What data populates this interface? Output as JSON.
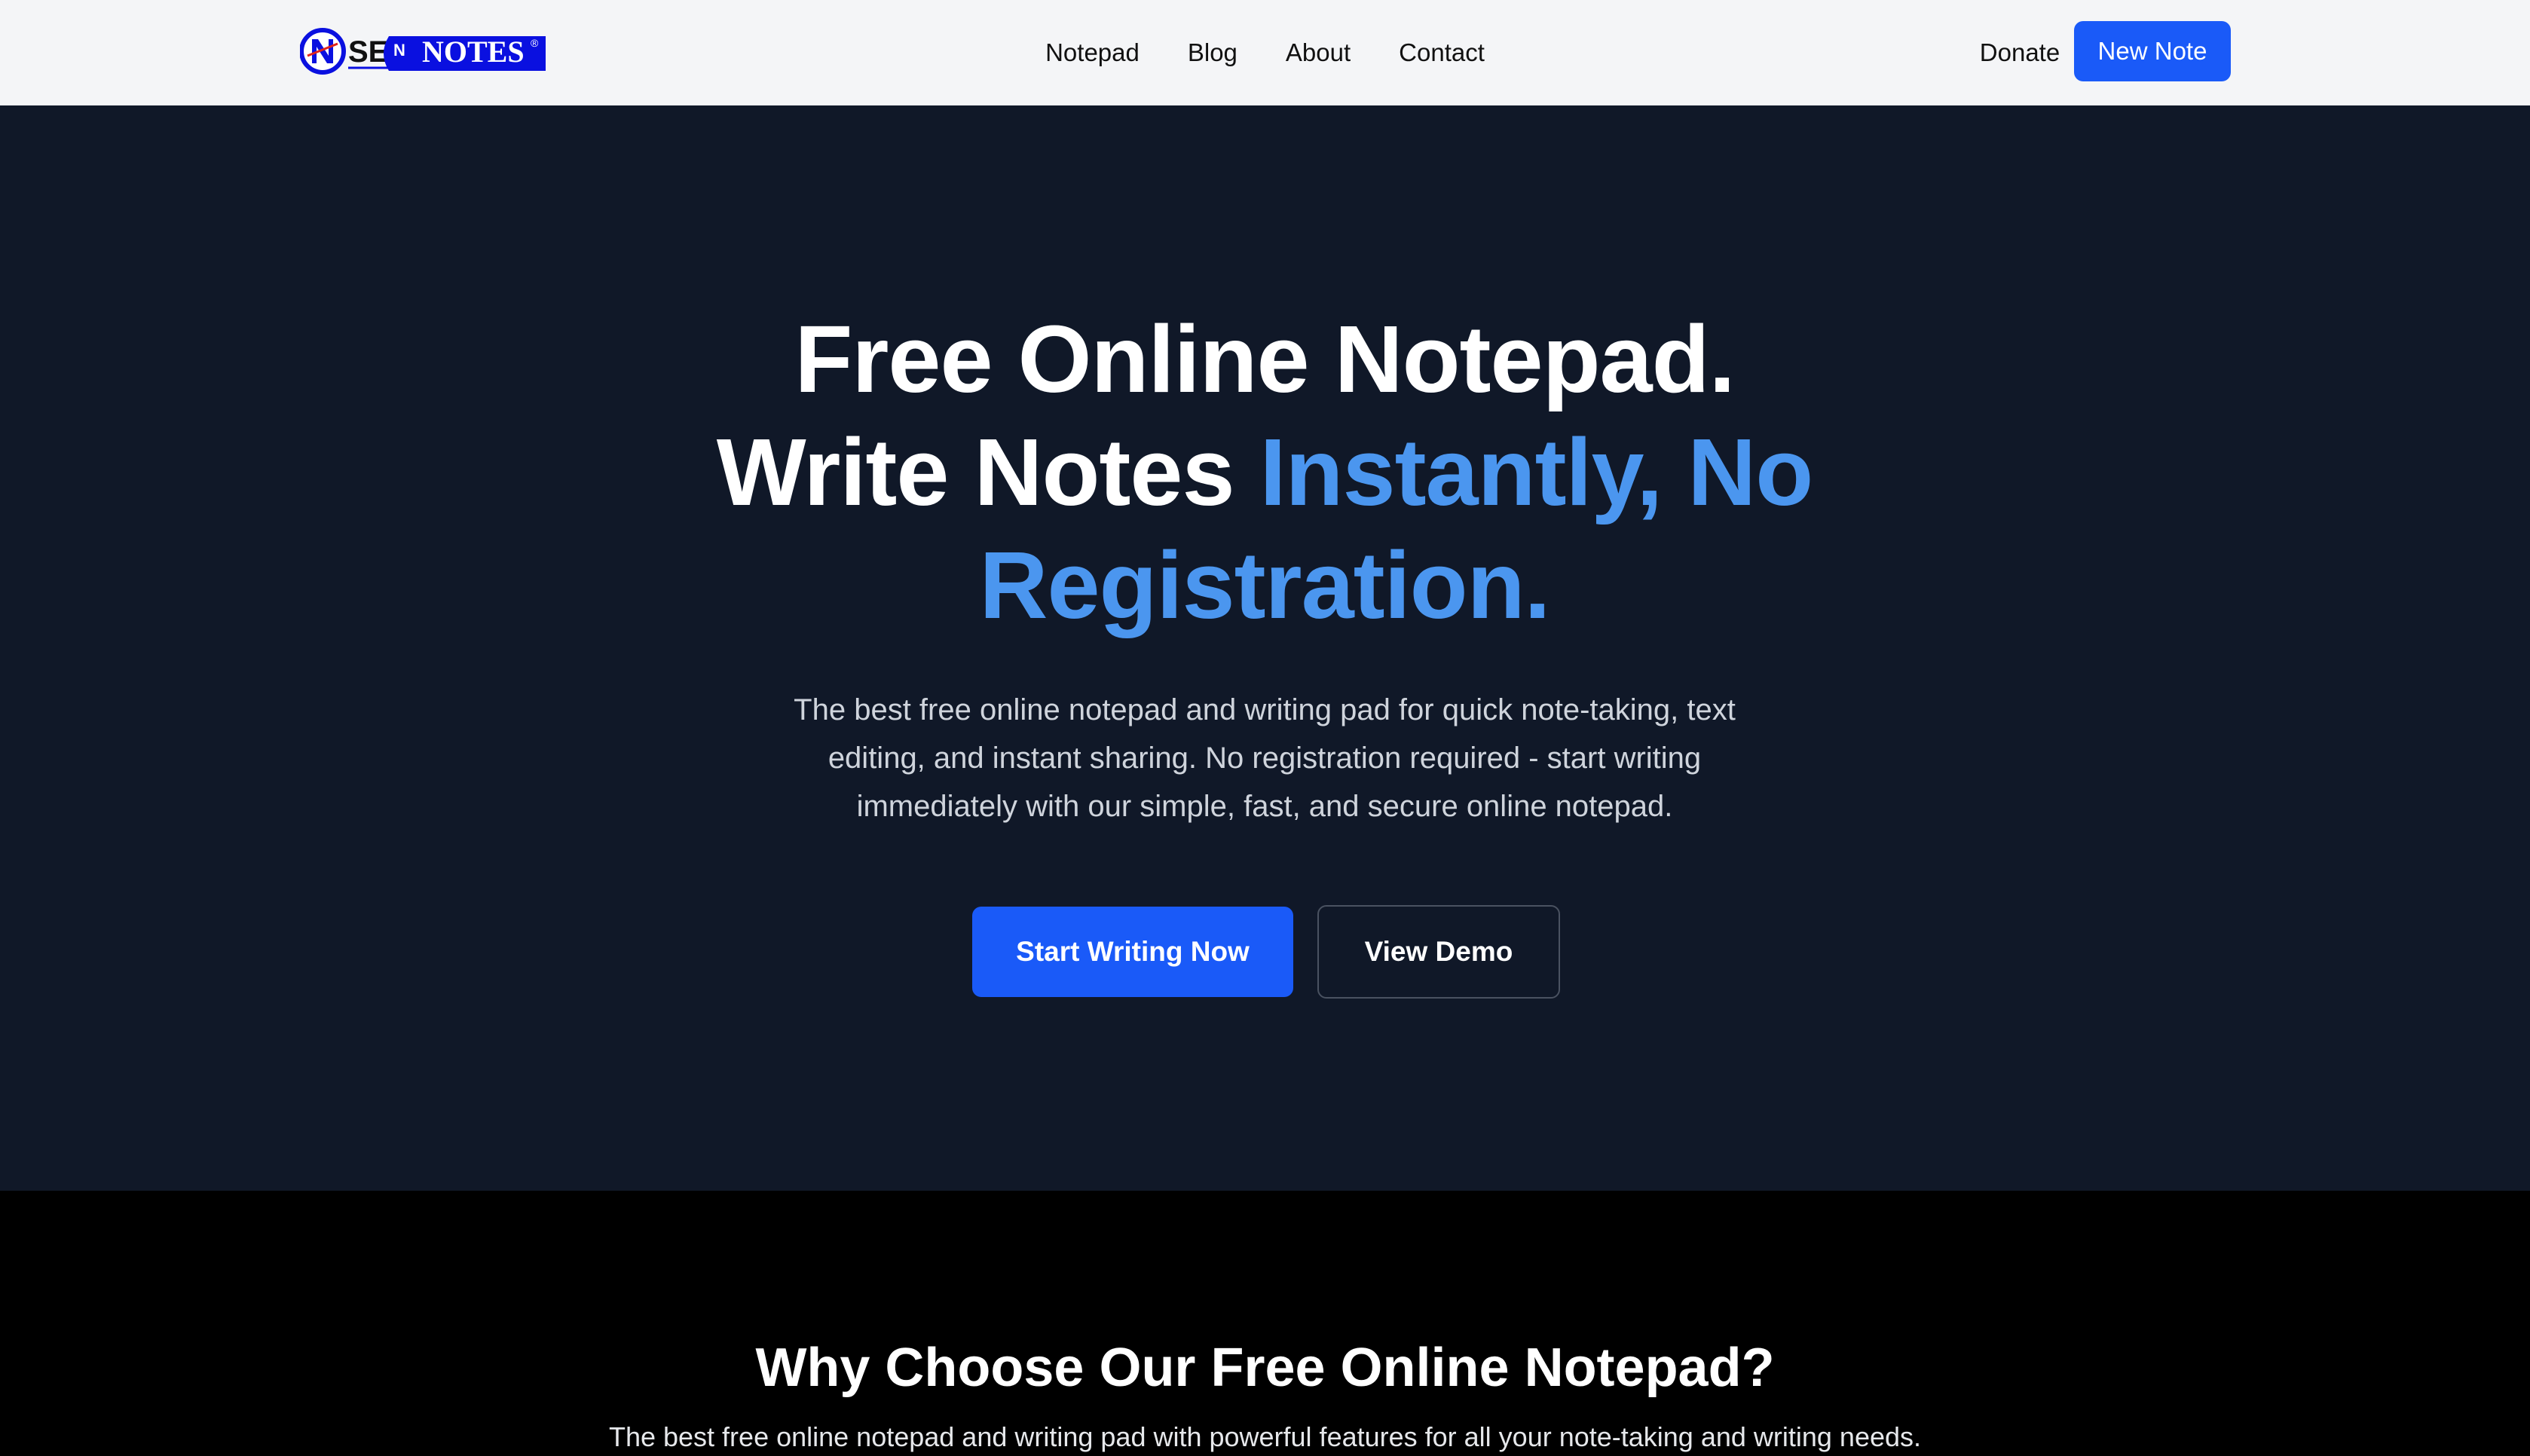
{
  "header": {
    "logo_text": "SEN NOTES",
    "nav": [
      {
        "label": "Notepad"
      },
      {
        "label": "Blog"
      },
      {
        "label": "About"
      },
      {
        "label": "Contact"
      }
    ],
    "donate_label": "Donate",
    "new_note_label": "New Note"
  },
  "hero": {
    "title_line1": "Free Online Notepad.",
    "title_line2_plain": "Write Notes ",
    "title_line2_accent": "Instantly, No",
    "title_line3_accent": "Registration.",
    "description": "The best free online notepad and writing pad for quick note-taking, text editing, and instant sharing. No registration required - start writing immediately with our simple, fast, and secure online notepad.",
    "primary_cta": "Start Writing Now",
    "secondary_cta": "View Demo"
  },
  "features": {
    "title": "Why Choose Our Free Online Notepad?",
    "subtitle": "The best free online notepad and writing pad with powerful features for all your note-taking and writing needs."
  },
  "colors": {
    "brand_blue": "#1a5af8",
    "accent_text": "#4b96ef",
    "hero_bg": "#101828",
    "header_bg": "#f4f5f7",
    "logo_blue": "#0a10e0"
  }
}
